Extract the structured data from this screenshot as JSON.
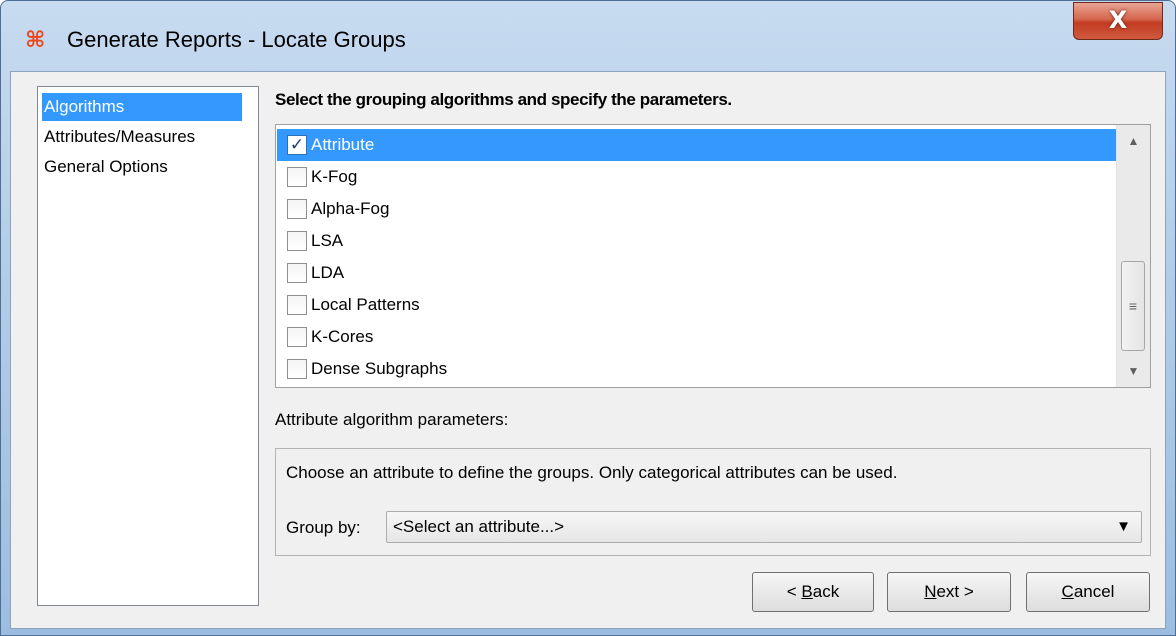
{
  "window": {
    "title": "Generate Reports - Locate Groups",
    "app_icon_glyph": "⌘",
    "close_glyph": "X"
  },
  "sidebar": {
    "items": [
      {
        "label": "Algorithms",
        "selected": true
      },
      {
        "label": "Attributes/Measures",
        "selected": false
      },
      {
        "label": "General Options",
        "selected": false
      }
    ]
  },
  "main": {
    "heading": "Select the grouping algorithms and specify the parameters.",
    "algorithms": [
      {
        "label": "Attribute",
        "checked": true,
        "selected": true
      },
      {
        "label": "K-Fog",
        "checked": false,
        "selected": false
      },
      {
        "label": "Alpha-Fog",
        "checked": false,
        "selected": false
      },
      {
        "label": "LSA",
        "checked": false,
        "selected": false
      },
      {
        "label": "LDA",
        "checked": false,
        "selected": false
      },
      {
        "label": "Local Patterns",
        "checked": false,
        "selected": false
      },
      {
        "label": "K-Cores",
        "checked": false,
        "selected": false
      },
      {
        "label": "Dense Subgraphs",
        "checked": false,
        "selected": false
      }
    ],
    "params_label": "Attribute algorithm parameters:",
    "params_description": "Choose an attribute to define the groups. Only categorical attributes can be used.",
    "group_by_label": "Group by:",
    "group_by_value": "<Select an attribute...>"
  },
  "buttons": {
    "back": {
      "prefix": "< ",
      "mnemonic": "B",
      "rest": "ack"
    },
    "next": {
      "mnemonic": "N",
      "rest": "ext >"
    },
    "cancel": {
      "mnemonic": "C",
      "rest": "ancel"
    }
  },
  "icons": {
    "check": "✓",
    "scroll_up": "▲",
    "scroll_down": "▼",
    "scroll_grip": "≡",
    "dropdown": "▼"
  },
  "colors": {
    "selection": "#3399ff",
    "close_button": "#c43c22",
    "app_icon": "#e8481c"
  }
}
